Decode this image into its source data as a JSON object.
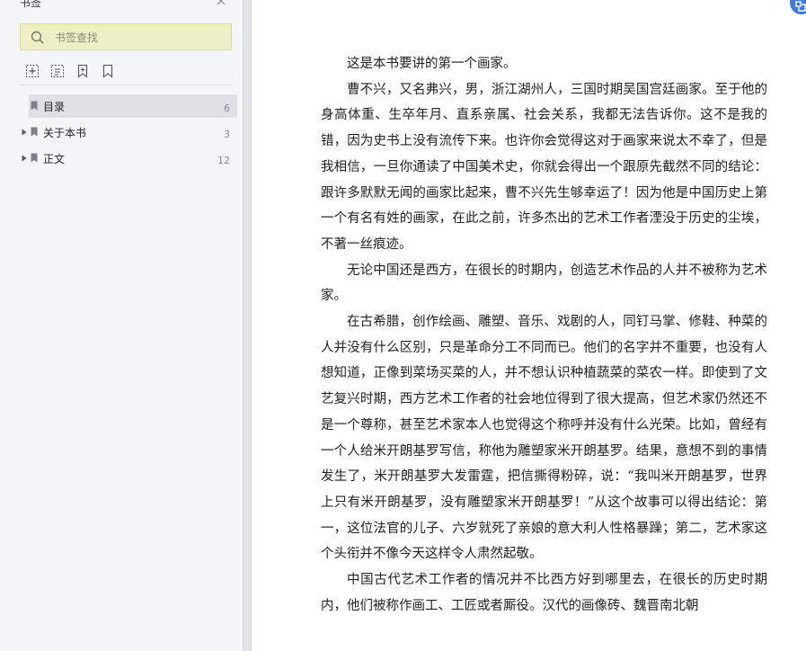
{
  "sidebar": {
    "title": "书签",
    "search": {
      "placeholder": "书签查找",
      "value": ""
    },
    "toolbar": [
      {
        "icon": "add-bookmark-icon"
      },
      {
        "icon": "add-sub-bookmark-icon"
      },
      {
        "icon": "bookmark-flag-icon"
      },
      {
        "icon": "bookmark-outline-icon"
      }
    ],
    "items": [
      {
        "label": "目录",
        "count": "6",
        "selected": true,
        "expandable": false
      },
      {
        "label": "关于本书",
        "count": "3",
        "selected": false,
        "expandable": true
      },
      {
        "label": "正文",
        "count": "12",
        "selected": false,
        "expandable": true
      }
    ]
  },
  "content": {
    "paragraphs": [
      "这是本书要讲的第一个画家。",
      "曹不兴，又名弗兴，男，浙江湖州人，三国时期吴国宫廷画家。至于他的身高体重、生卒年月、直系亲属、社会关系，我都无法告诉你。这不是我的错，因为史书上没有流传下来。也许你会觉得这对于画家来说太不幸了，但是我相信，一旦你通读了中国美术史，你就会得出一个跟原先截然不同的结论：跟许多默默无闻的画家比起来，曹不兴先生够幸运了！因为他是中国历史上第一个有名有姓的画家，在此之前，许多杰出的艺术工作者湮没于历史的尘埃，不著一丝痕迹。",
      "无论中国还是西方，在很长的时期内，创造艺术作品的人并不被称为艺术家。",
      "在古希腊，创作绘画、雕塑、音乐、戏剧的人，同钉马掌、修鞋、种菜的人并没有什么区别，只是革命分工不同而已。他们的名字并不重要，也没有人想知道，正像到菜场买菜的人，并不想认识种植蔬菜的菜农一样。即使到了文艺复兴时期，西方艺术工作者的社会地位得到了很大提高，但艺术家仍然还不是一个尊称，甚至艺术家本人也觉得这个称呼并没有什么光荣。比如，曾经有一个人给米开朗基罗写信，称他为雕塑家米开朗基罗。结果，意想不到的事情发生了，米开朗基罗大发雷霆，把信撕得粉碎，说：“我叫米开朗基罗，世界上只有米开朗基罗，没有雕塑家米开朗基罗！”从这个故事可以得出结论：第一，这位法官的儿子、六岁就死了亲娘的意大利人性格暴躁；第二，艺术家这个头衔并不像今天这样令人肃然起敬。",
      "中国古代艺术工作者的情况并不比西方好到哪里去，在很长的历史时期内，他们被称作画工、工匠或者厮役。汉代的画像砖、魏晋南北朝"
    ]
  },
  "colors": {
    "sidebar_bg": "#f4f5f7",
    "search_bg": "#eeefc6",
    "selected_row": "#dfe0e5",
    "badge_blue": "#3f79e0"
  }
}
